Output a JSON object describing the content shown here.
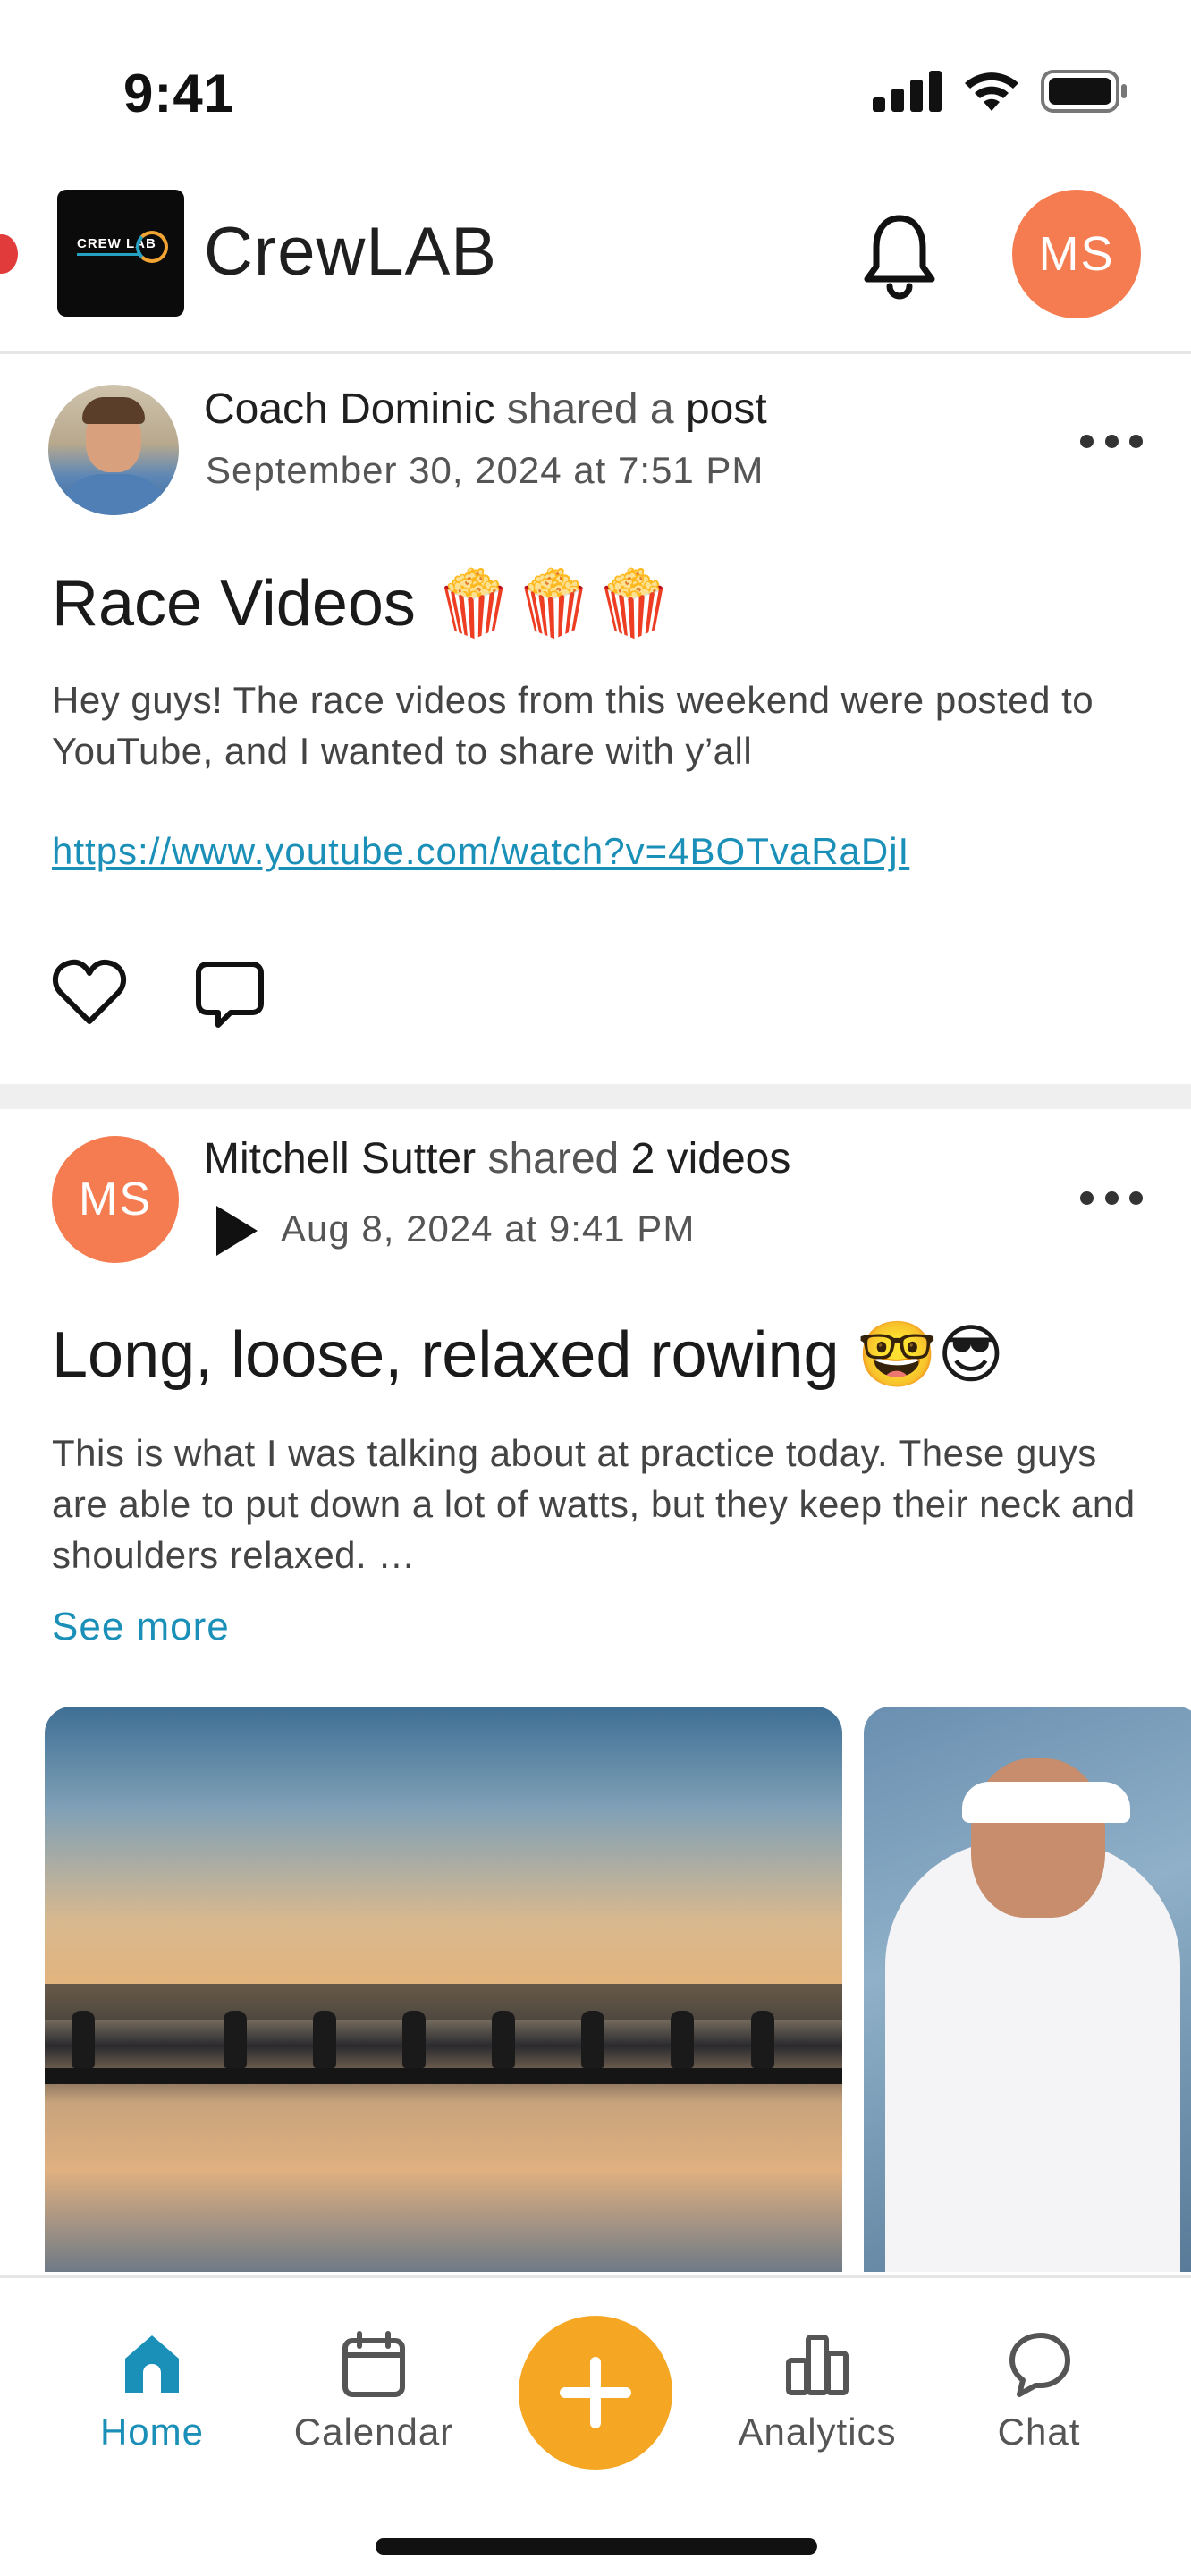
{
  "status_bar": {
    "time": "9:41"
  },
  "header": {
    "app_name": "CrewLAB",
    "logo_text": "CREW LAB",
    "avatar_initials": "MS"
  },
  "posts": [
    {
      "author": "Coach Dominic",
      "action_verb": "shared a",
      "object": "post",
      "date": "September 30, 2024 at 7:51 PM",
      "title": "Race Videos 🍿🍿🍿",
      "body": "Hey guys! The race videos from this weekend were posted to YouTube, and I wanted to share with y’all",
      "link": "https://www.youtube.com/watch?v=4BOTvaRaDjI"
    },
    {
      "author": "Mitchell Sutter",
      "author_initials": "MS",
      "action_verb": "shared",
      "object": "2 videos",
      "date": "Aug 8, 2024 at 9:41 PM",
      "title": "Long, loose, relaxed rowing 🤓😎",
      "body": "This is what I was talking about at practice today. These guys are able to put down a lot of watts, but they keep their neck and shoulders relaxed. …",
      "see_more": "See more"
    }
  ],
  "bottom_nav": {
    "items": [
      {
        "label": "Home",
        "icon": "home-icon",
        "active": true
      },
      {
        "label": "Calendar",
        "icon": "calendar-icon",
        "active": false
      },
      {
        "label": "Analytics",
        "icon": "analytics-icon",
        "active": false
      },
      {
        "label": "Chat",
        "icon": "chat-icon",
        "active": false
      }
    ],
    "add_icon": "plus-icon"
  },
  "colors": {
    "accent": "#1a8fb7",
    "avatar": "#f47c50",
    "add_button": "#f5a623"
  }
}
